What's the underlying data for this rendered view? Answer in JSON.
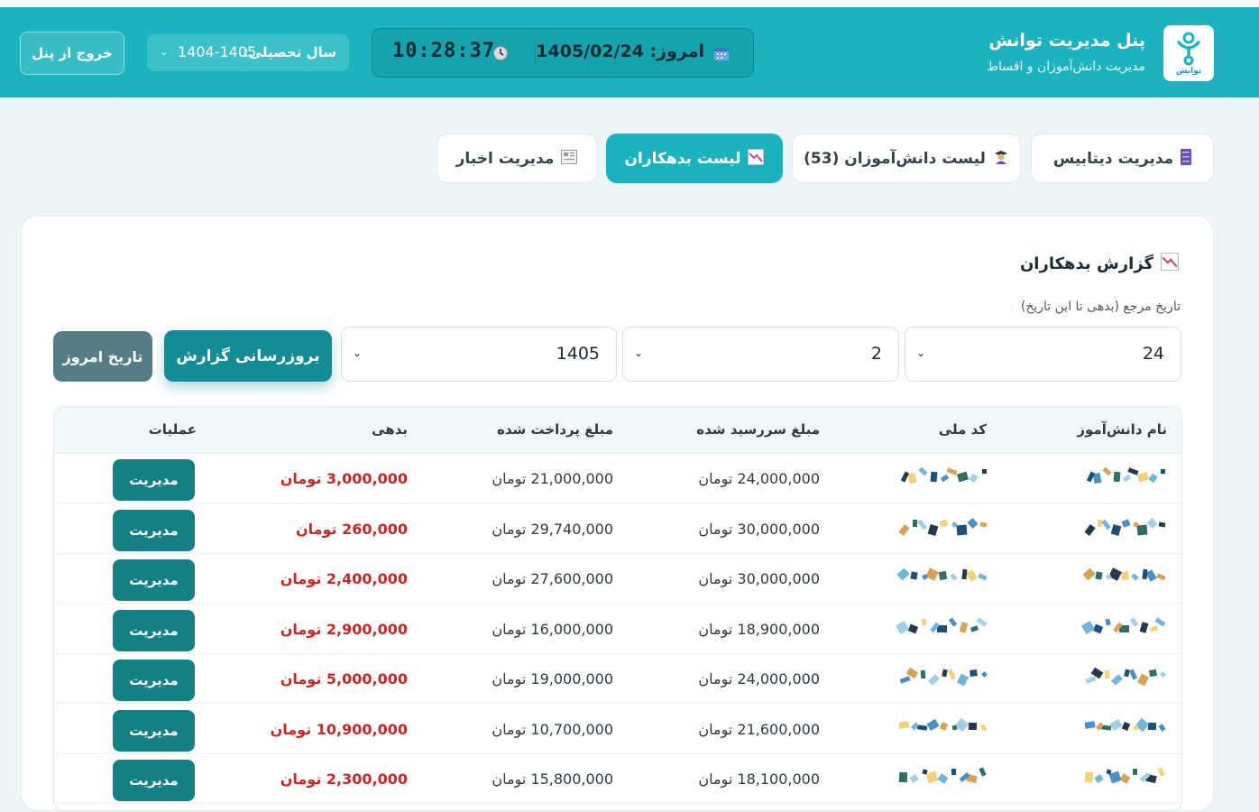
{
  "header": {
    "brand_title": "پنل مدیریت توانش",
    "brand_subtitle": "مدیریت دانش‌آموزان و اقساط",
    "logo_text": "توانش",
    "date_label": "امروز: 1405/02/24",
    "time": "10:28:37",
    "year_label": "سال تحصیلی:",
    "year_value": "1404-1405",
    "logout": "خروج از پنل"
  },
  "tabs": [
    {
      "label": "مدیریت دیتابیس",
      "icon": "database-icon"
    },
    {
      "label": "لیست دانش‌آموزان (53)",
      "icon": "student-icon"
    },
    {
      "label": "لیست بدهکاران",
      "icon": "chart-down-icon",
      "active": true
    },
    {
      "label": "مدیریت اخبار",
      "icon": "news-icon"
    }
  ],
  "report": {
    "title": "گزارش بدهکاران",
    "ref_label": "تاریخ مرجع (بدهی تا این تاریخ)",
    "day": "24",
    "month": "2",
    "year": "1405",
    "update_button": "بروزرسانی گزارش",
    "today_button": "تاریخ امروز"
  },
  "table": {
    "headers": [
      "نام دانش‌آموز",
      "کد ملی",
      "مبلغ سررسید شده",
      "مبلغ پرداخت شده",
      "بدهی",
      "عملیات"
    ],
    "manage_label": "مدیریت",
    "rows": [
      {
        "due": "24,000,000 تومان",
        "paid": "21,000,000 تومان",
        "debt": "3,000,000 تومان"
      },
      {
        "due": "30,000,000 تومان",
        "paid": "29,740,000 تومان",
        "debt": "260,000 تومان"
      },
      {
        "due": "30,000,000 تومان",
        "paid": "27,600,000 تومان",
        "debt": "2,400,000 تومان"
      },
      {
        "due": "18,900,000 تومان",
        "paid": "16,000,000 تومان",
        "debt": "2,900,000 تومان"
      },
      {
        "due": "24,000,000 تومان",
        "paid": "19,000,000 تومان",
        "debt": "5,000,000 تومان"
      },
      {
        "due": "21,600,000 تومان",
        "paid": "10,700,000 تومان",
        "debt": "10,900,000 تومان"
      },
      {
        "due": "18,100,000 تومان",
        "paid": "15,800,000 تومان",
        "debt": "2,300,000 تومان"
      }
    ]
  },
  "colors": {
    "primary": "#1bb3bf",
    "dark_teal": "#157f86",
    "debt_red": "#c62828"
  }
}
